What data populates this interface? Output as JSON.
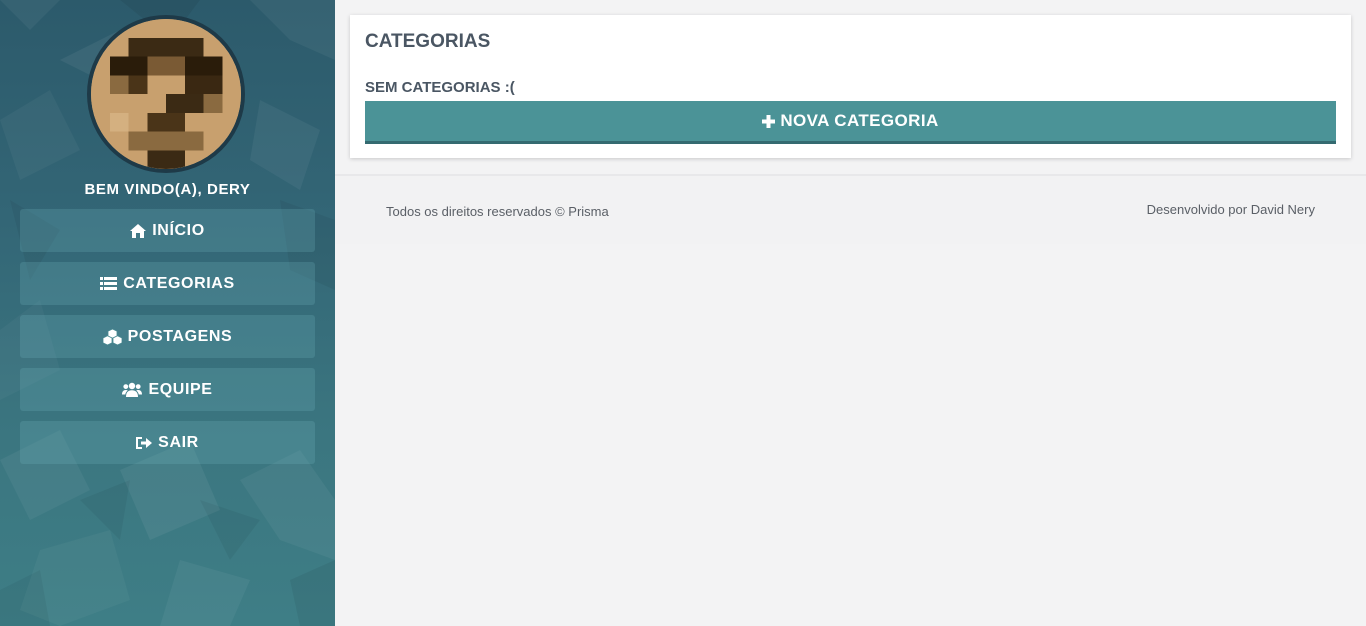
{
  "sidebar": {
    "welcome": "BEM VINDO(A), DERY",
    "avatar_icon": "user-avatar-pixelated",
    "items": [
      {
        "label": "INÍCIO",
        "icon": "home-icon"
      },
      {
        "label": "CATEGORIAS",
        "icon": "list-icon"
      },
      {
        "label": "POSTAGENS",
        "icon": "cubes-icon"
      },
      {
        "label": "EQUIPE",
        "icon": "users-icon"
      },
      {
        "label": "SAIR",
        "icon": "sign-out-icon"
      }
    ]
  },
  "main": {
    "title": "CATEGORIAS",
    "empty_message": "SEM CATEGORIAS :(",
    "new_button_label": "NOVA CATEGORIA",
    "new_button_icon": "plus-icon"
  },
  "footer": {
    "left": "Todos os direitos reservados © Prisma",
    "right": "Desenvolvido por David Nery"
  },
  "colors": {
    "sidebar_top": "#2c5a6b",
    "sidebar_bottom": "#3e7e86",
    "accent_button": "#4b9397",
    "heading_text": "#4a5663",
    "page_background": "#f3f3f4"
  }
}
